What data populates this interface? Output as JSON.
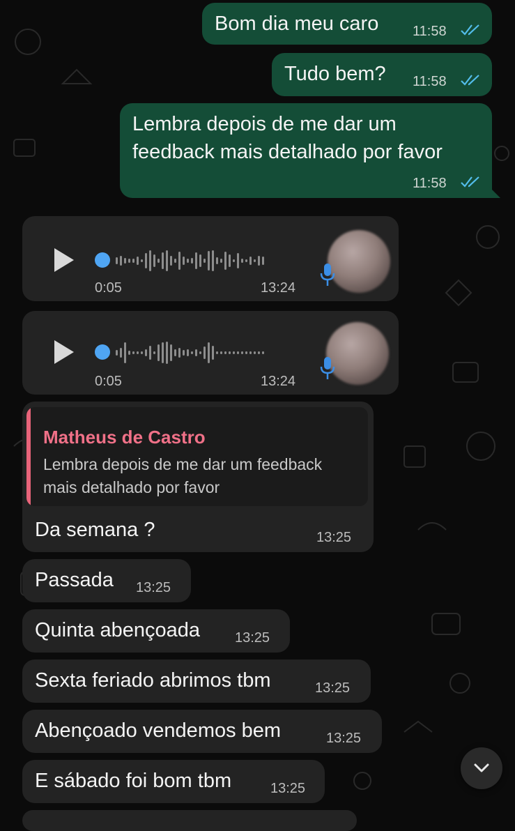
{
  "colors": {
    "outgoing_bubble": "#144d37",
    "incoming_bubble": "#232323",
    "read_ticks": "#53bdeb",
    "quote_accent": "#e8647a",
    "voice_dot": "#4fa5f3"
  },
  "messages": {
    "m1": {
      "text": "Bom dia meu caro",
      "time": "11:58"
    },
    "m2": {
      "text": "Tudo bem?",
      "time": "11:58"
    },
    "m3": {
      "line1": "Lembra depois de me dar um",
      "line2": "feedback mais detalhado por favor",
      "time": "11:58"
    },
    "voice1": {
      "duration": "0:05",
      "time": "13:24"
    },
    "voice2": {
      "duration": "0:05",
      "time": "13:24"
    },
    "reply": {
      "quoted_author": "Matheus de Castro",
      "quoted_line1": "Lembra depois de me dar um feedback",
      "quoted_line2": "mais detalhado por favor",
      "text": "Da semana ?",
      "time": "13:25"
    },
    "m5": {
      "text": "Passada",
      "time": "13:25"
    },
    "m6": {
      "text": "Quinta abençoada",
      "time": "13:25"
    },
    "m7": {
      "text": "Sexta feriado abrimos tbm",
      "time": "13:25"
    },
    "m8": {
      "text": "Abençoado vendemos bem",
      "time": "13:25"
    },
    "m9": {
      "text": "E sábado foi bom tbm",
      "time": "13:25"
    }
  },
  "icons": {
    "read_receipt": "double-check-icon",
    "play": "play-icon",
    "microphone": "microphone-icon",
    "scroll_down": "chevron-down-icon"
  }
}
